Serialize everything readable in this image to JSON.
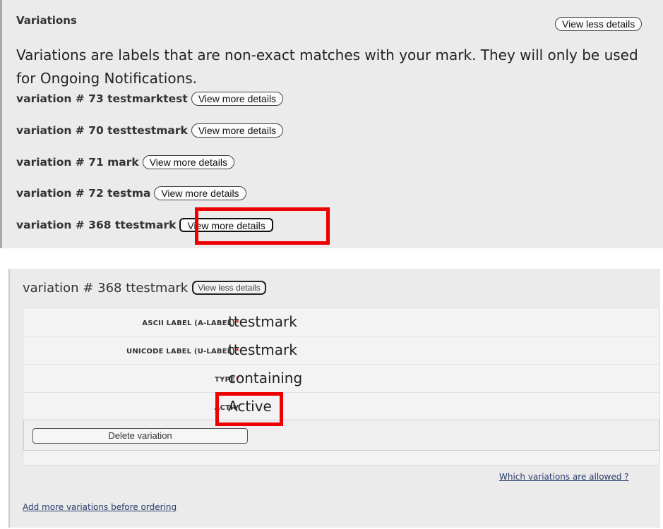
{
  "variations_panel": {
    "title": "Variations",
    "view_less_label": "View less details",
    "description": "Variations are labels that are non-exact matches with your mark. They will only be used for Ongoing Notifications.",
    "items": [
      {
        "label": "variation # 73 testmarktest",
        "button": "View more details"
      },
      {
        "label": "variation # 70 testtestmark",
        "button": "View more details"
      },
      {
        "label": "variation # 71 mark",
        "button": "View more details"
      },
      {
        "label": "variation # 72 testma",
        "button": "View more details"
      },
      {
        "label": "variation # 368 ttestmark",
        "button": "View more details"
      }
    ]
  },
  "detail_panel": {
    "title": "variation # 368 ttestmark",
    "view_less_label": "View less details",
    "fields": [
      {
        "label": "ASCII LABEL (A-LABEL)",
        "required": "*",
        "value": "ttestmark"
      },
      {
        "label": "UNICODE LABEL (U-LABEL)",
        "required": "*",
        "value": "ttestmark"
      },
      {
        "label": "TYPE",
        "required": "*",
        "value": "containing"
      },
      {
        "label": "ACTIV",
        "required": "",
        "value": "Active"
      }
    ],
    "delete_label": "Delete variation",
    "which_link": "Which variations are allowed ?",
    "add_link": "Add more variations before ordering"
  },
  "colors": {
    "highlight": "#ee0000",
    "panel_bg": "#ebebeb",
    "link": "#2a3b6b"
  }
}
